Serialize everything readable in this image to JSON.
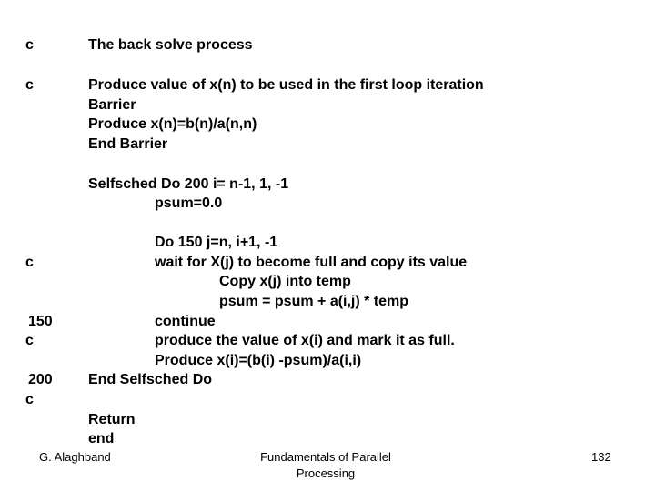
{
  "slide": {
    "code": [
      {
        "label": "c",
        "text": "The back solve process",
        "indent": 0
      },
      {
        "label": "c",
        "text": "Produce value of x(n) to be used in the first loop iteration",
        "indent": 0
      },
      {
        "label": "",
        "text": "Barrier",
        "indent": 0
      },
      {
        "label": "",
        "text": "Produce x(n)=b(n)/a(n,n)",
        "indent": 0
      },
      {
        "label": "",
        "text": "End Barrier",
        "indent": 0
      },
      {
        "label": "",
        "text": "Selfsched Do 200 i= n-1, 1, -1",
        "indent": 0
      },
      {
        "label": "",
        "text": "psum=0.0",
        "indent": 1
      },
      {
        "label": "",
        "text": "Do 150 j=n, i+1, -1",
        "indent": 1
      },
      {
        "label": "c",
        "text": "wait for X(j) to become full and copy its value",
        "indent": 1
      },
      {
        "label": "",
        "text": "Copy x(j) into temp",
        "indent": 2
      },
      {
        "label": "",
        "text": "psum = psum + a(i,j) * temp",
        "indent": 2
      },
      {
        "label": "150",
        "text": "continue",
        "indent": 1
      },
      {
        "label": "c",
        "text": "produce the value of x(i) and mark it as full.",
        "indent": 1
      },
      {
        "label": "",
        "text": "Produce x(i)=(b(i) -psum)/a(i,i)",
        "indent": 1
      },
      {
        "label": "200",
        "text": "End Selfsched Do",
        "indent": 0
      },
      {
        "label": "c",
        "text": "",
        "indent": 0
      },
      {
        "label": "",
        "text": "Return",
        "indent": 0
      },
      {
        "label": "",
        "text": "end",
        "indent": 0
      }
    ]
  },
  "footer": {
    "author": "G. Alaghband",
    "title": "Fundamentals of Parallel Processing",
    "page_number": "132"
  }
}
